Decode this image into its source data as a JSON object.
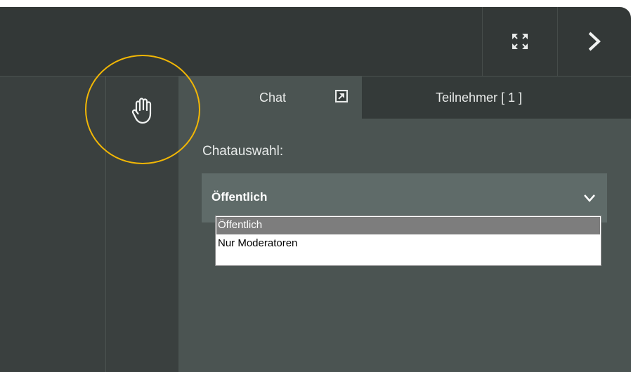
{
  "toolbar": {
    "fullscreen_icon": "expand-icon",
    "next_icon": "chevron-right-icon"
  },
  "raise_hand": {
    "icon": "hand-icon"
  },
  "tabs": [
    {
      "label": "Chat",
      "icon": "popout-icon",
      "active": true
    },
    {
      "label": "Teilnehmer [ 1 ]",
      "active": false
    }
  ],
  "chat_select": {
    "label": "Chatauswahl:",
    "value": "Öffentlich",
    "options": [
      "Öffentlich",
      "Nur Moderatoren"
    ]
  },
  "colors": {
    "accent": "#f2b705",
    "panel": "#4b5452",
    "topbar": "#333837",
    "select": "#5f6b69"
  }
}
